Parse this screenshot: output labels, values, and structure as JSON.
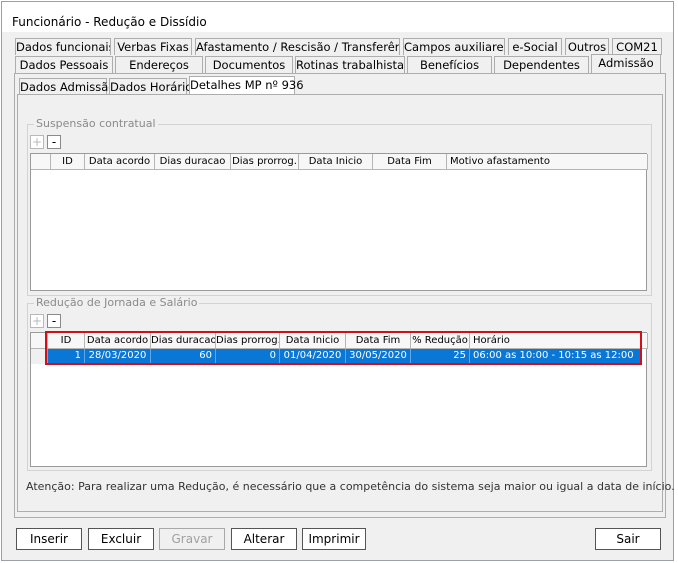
{
  "window": {
    "title": "Funcionário - Redução e Dissídio"
  },
  "tabs_row1": [
    "Dados funcionais",
    "Verbas Fixas",
    "Afastamento / Rescisão / Transferência",
    "Campos auxiliares",
    "e-Social",
    "Outros",
    "COM21"
  ],
  "tabs_row2": [
    "Dados Pessoais",
    "Endereços",
    "Documentos",
    "Rotinas trabalhistas",
    "Benefícios",
    "Dependentes",
    "Admissão"
  ],
  "subtabs": [
    "Dados Admissão",
    "Dados Horário",
    "Detalhes MP nº 936"
  ],
  "suspensao": {
    "title": "Suspensão contratual",
    "add_symbol": "+",
    "remove_symbol": "-",
    "columns": [
      "ID",
      "Data acordo",
      "Dias duracao",
      "Dias prorrog.",
      "Data Inicio",
      "Data Fim",
      "Motivo afastamento"
    ]
  },
  "reducao": {
    "title": "Redução de Jornada e Salário",
    "add_symbol": "+",
    "remove_symbol": "-",
    "columns": [
      "ID",
      "Data acordo",
      "Dias duracao",
      "Dias prorrog.",
      "Data Inicio",
      "Data Fim",
      "% Redução",
      "Horário"
    ],
    "rows": [
      {
        "id": "1",
        "data_acordo": "28/03/2020",
        "dias_duracao": "60",
        "dias_prorrog": "0",
        "data_inicio": "01/04/2020",
        "data_fim": "30/05/2020",
        "reducao": "25",
        "horario": "06:00 as 10:00 - 10:15 as 12:00"
      }
    ]
  },
  "notice": "Atenção: Para realizar uma Redução, é necessário que a competência do sistema seja maior ou igual a data de início.",
  "buttons": {
    "inserir": "Inserir",
    "excluir": "Excluir",
    "gravar": "Gravar",
    "alterar": "Alterar",
    "imprimir": "Imprimir",
    "sair": "Sair"
  },
  "colors": {
    "selection": "#0a76d6",
    "highlight_border": "#d20f16"
  }
}
